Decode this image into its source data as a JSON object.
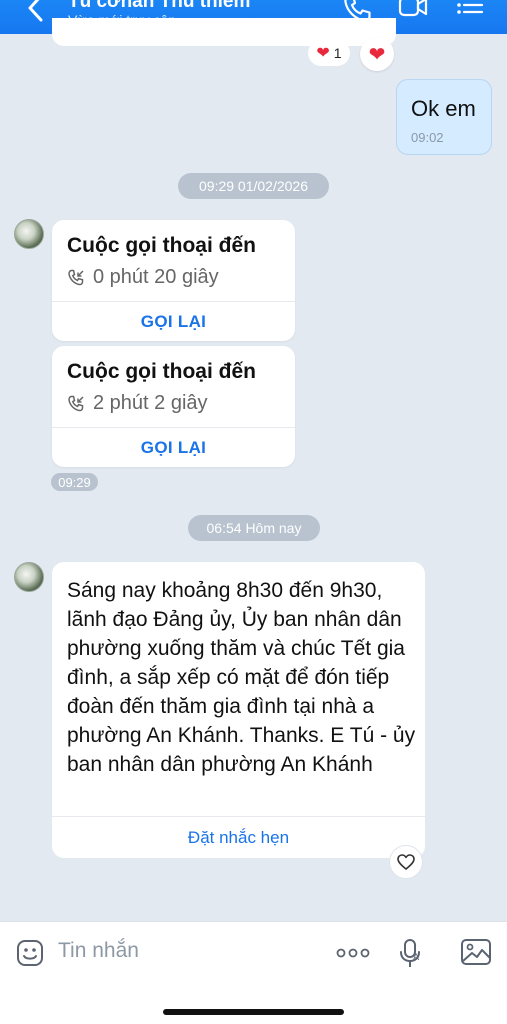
{
  "header": {
    "title": "Tú cơnan Thủ thiêm",
    "status": "Vừa mới truy cập"
  },
  "reaction": {
    "count": "1"
  },
  "outgoing": {
    "text": "Ok em",
    "time": "09:02"
  },
  "separators": {
    "first": "09:29 01/02/2026",
    "second": "06:54 Hôm nay"
  },
  "calls": [
    {
      "title": "Cuộc gọi thoại đến",
      "duration": "0 phút 20 giây",
      "action": "GỌI LẠI"
    },
    {
      "title": "Cuộc gọi thoại đến",
      "duration": "2 phút 2 giây",
      "action": "GỌI LẠI"
    }
  ],
  "calls_time": "09:29",
  "incoming_text": {
    "body": "Sáng nay khoảng 8h30 đến 9h30, lãnh đạo Đảng ủy, Ủy ban nhân dân phường xuống thăm và chúc Tết gia đình, a sắp xếp có mặt để đón tiếp đoàn đến thăm gia đình tại nhà a phường An Khánh. Thanks. E Tú - ủy ban nhân dân phường An Khánh",
    "action": "Đặt nhắc hẹn"
  },
  "composer": {
    "placeholder": "Tin nhắn"
  },
  "colors": {
    "header": "#1677f0",
    "link": "#1a73e8",
    "outgoing_bubble": "#d5ebff",
    "background": "#e2e9f1",
    "heart": "#e8283b"
  },
  "icons": [
    "back-arrow-icon",
    "phone-icon",
    "video-call-icon",
    "menu-icon",
    "heart-icon",
    "incoming-call-icon",
    "like-heart-icon",
    "emoji-icon",
    "more-options-icon",
    "voice-icon",
    "image-icon"
  ]
}
